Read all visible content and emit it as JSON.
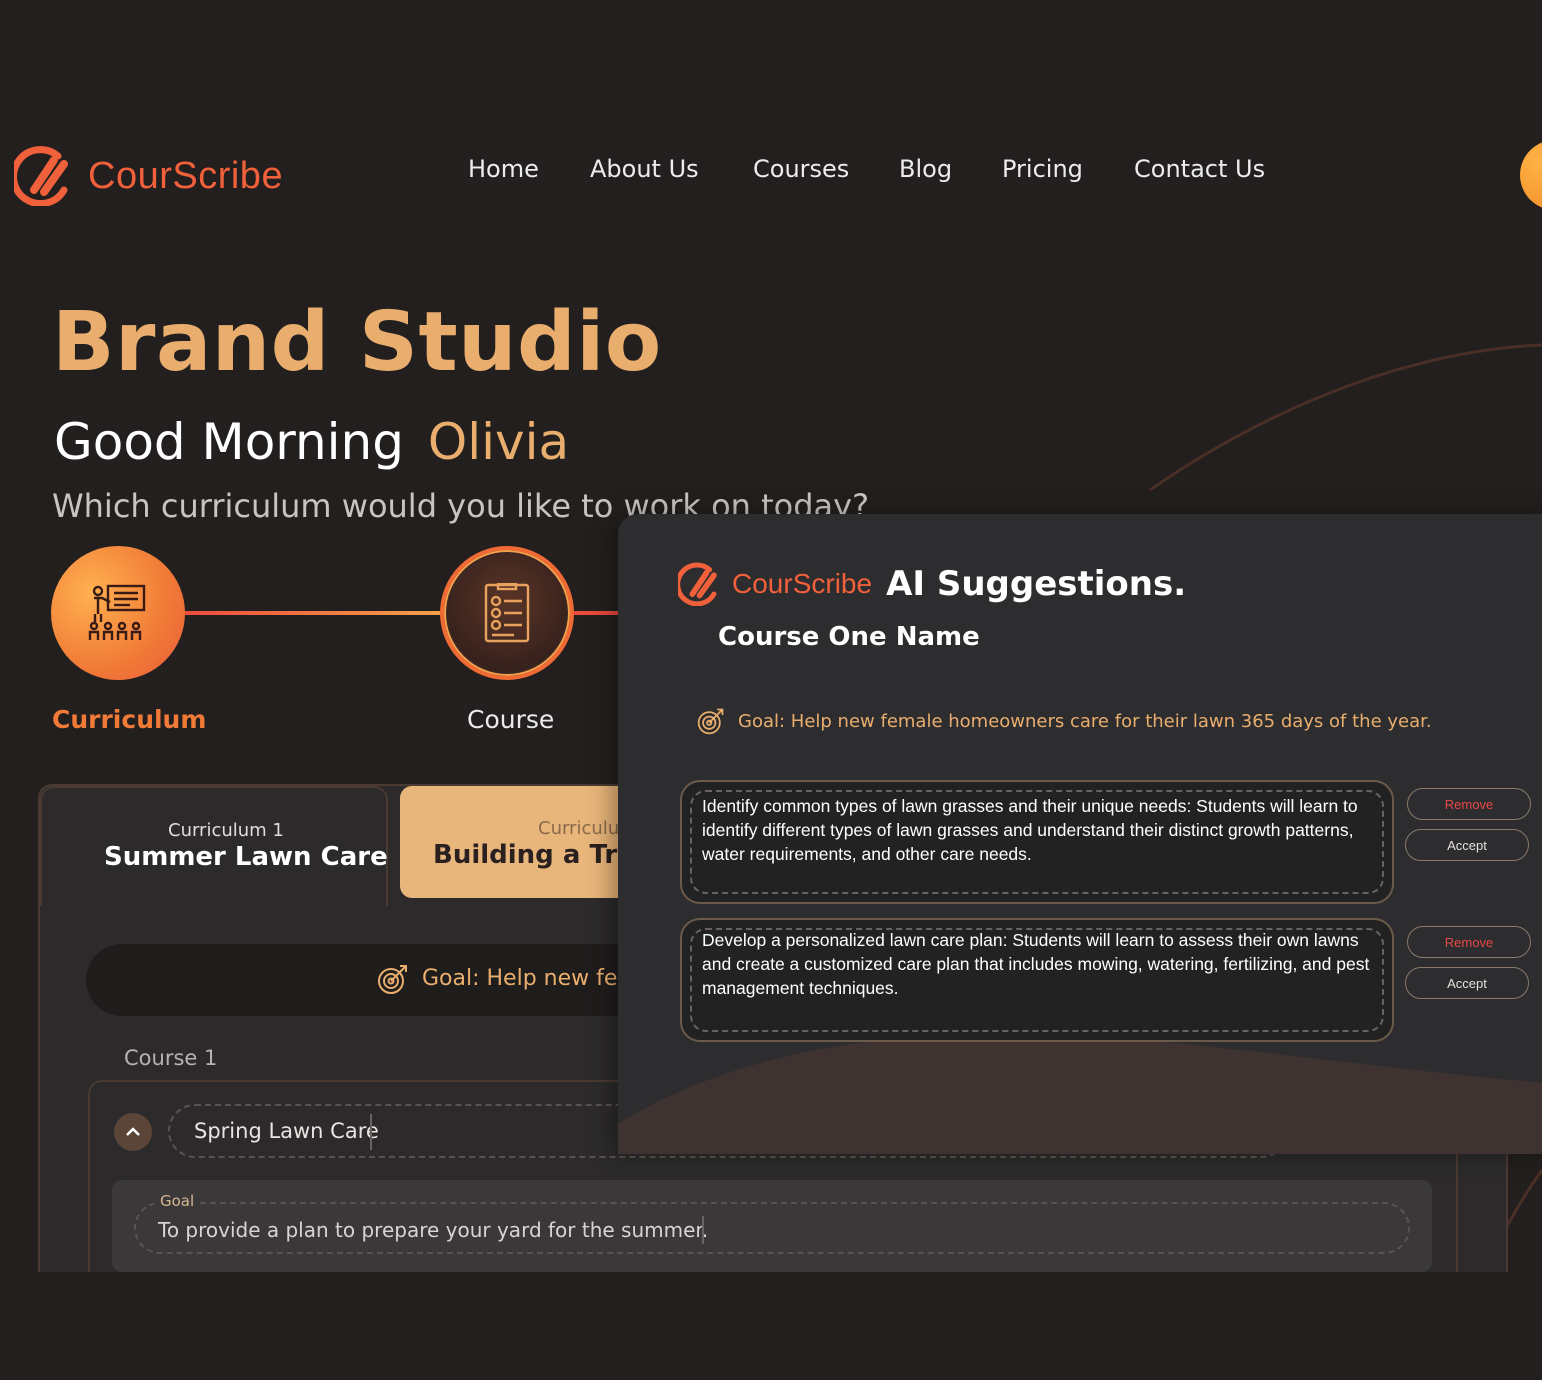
{
  "brand": {
    "name": "CourScribe",
    "accent": "#f0603a",
    "gold": "#e9ae6e"
  },
  "nav": {
    "items": [
      "Home",
      "About Us",
      "Courses",
      "Blog",
      "Pricing",
      "Contact Us"
    ]
  },
  "hero": {
    "title": "Brand Studio",
    "greeting": "Good Morning",
    "user_name": "Olivia",
    "question": "Which curriculum would you like to work on today?"
  },
  "steps": [
    {
      "label": "Curriculum",
      "icon": "presentation-classroom-icon",
      "active": true
    },
    {
      "label": "Course",
      "icon": "checklist-document-icon",
      "active": false
    }
  ],
  "curricula": [
    {
      "small": "Curriculum 1",
      "title": "Summer Lawn Care"
    },
    {
      "small": "Curriculum",
      "title": "Building a Truck"
    }
  ],
  "main_goal": {
    "label": "Goal:",
    "text": "Help new fema"
  },
  "course": {
    "label": "Course 1",
    "name": "Spring Lawn Care",
    "goal_label": "Goal",
    "goal": "To provide a plan to prepare your yard for the summer."
  },
  "ai": {
    "logo": "CourScribe",
    "title": "AI Suggestions.",
    "course_name": "Course One Name",
    "goal_label": "Goal:",
    "goal_text": "Help new female homeowners care for their lawn 365 days of the year.",
    "suggestions": [
      {
        "text": "Identify common types of lawn grasses and their unique needs: Students will learn to identify different types of lawn grasses and understand their distinct growth patterns, water requirements, and other care needs.",
        "remove": "Remove",
        "accept": "Accept"
      },
      {
        "text": "Develop a personalized lawn care plan: Students will learn to assess their own lawns and create a customized care plan that includes mowing, watering, fertilizing, and pest management techniques.",
        "remove": "Remove",
        "accept": "Accept"
      }
    ]
  }
}
